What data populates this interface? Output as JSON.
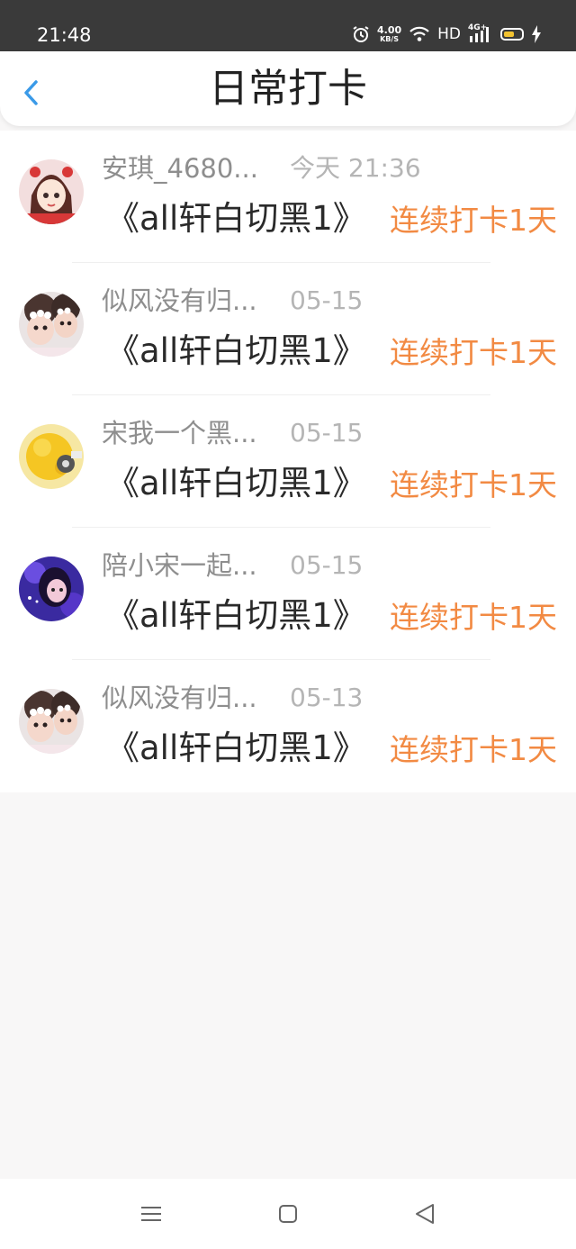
{
  "status_bar": {
    "time": "21:48",
    "net_speed_value": "4.00",
    "net_speed_unit": "KB/S",
    "hd_label": "HD",
    "network_type": "4G+",
    "icons": [
      "alarm-icon",
      "wifi-icon",
      "signal-icon",
      "battery-icon",
      "charging-icon"
    ]
  },
  "header": {
    "title": "日常打卡",
    "back_icon": "chevron-left-icon",
    "accent_color": "#3a9ae8"
  },
  "checkins": [
    {
      "user": "安琪_4680...",
      "time": "今天 21:36",
      "book": "《all轩白切黑1》",
      "streak": "连续打卡1天",
      "avatar": "avatar-anime-girl"
    },
    {
      "user": "似风没有归...",
      "time": "05-15",
      "book": "《all轩白切黑1》",
      "streak": "连续打卡1天",
      "avatar": "avatar-two-kids"
    },
    {
      "user": "宋我一个黑...",
      "time": "05-15",
      "book": "《all轩白切黑1》",
      "streak": "连续打卡1天",
      "avatar": "avatar-yellow-chick"
    },
    {
      "user": "陪小宋一起...",
      "time": "05-15",
      "book": "《all轩白切黑1》",
      "streak": "连续打卡1天",
      "avatar": "avatar-purple-portrait"
    },
    {
      "user": "似风没有归...",
      "time": "05-13",
      "book": "《all轩白切黑1》",
      "streak": "连续打卡1天",
      "avatar": "avatar-two-kids"
    }
  ],
  "colors": {
    "streak": "#f28a43",
    "username": "#8e8e8e",
    "timestamp": "#b5b5b5",
    "book_title": "#2a2a2a",
    "page_background": "#f8f7f7"
  },
  "nav_bar": {
    "icons": [
      "menu-icon",
      "home-square-icon",
      "back-triangle-icon"
    ]
  }
}
